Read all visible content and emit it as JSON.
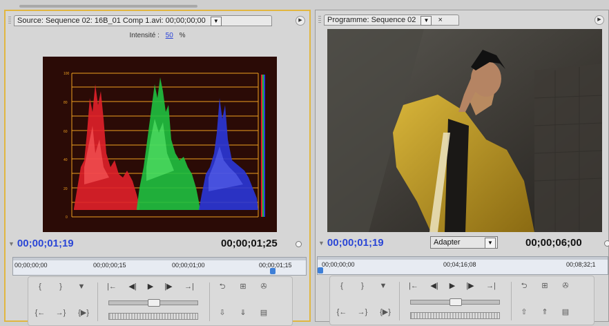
{
  "source": {
    "tab_title": "Source: Sequence 02: 16B_01 Comp 1.avi: 00;00;00;00",
    "dropdown_glyph": "▼",
    "menu_glyph": "▶",
    "intensity_label": "Intensité :",
    "intensity_value": "50",
    "intensity_unit": "%",
    "timecode_current": "00;00;01;19",
    "timecode_duration": "00;00;01;25",
    "ruler_ticks": [
      "00;00;00;00",
      "00;00;00;15",
      "00;00;01;00",
      "00;00;01;15"
    ]
  },
  "program": {
    "tab_title": "Programme: Sequence 02",
    "dropdown_glyph": "▼",
    "close_glyph": "×",
    "menu_glyph": "▶",
    "timecode_current": "00;00;01;19",
    "fit_label": "Adapter",
    "timecode_duration": "00;00;06;00",
    "ruler_ticks": [
      "00;00;00;00",
      "00;04;16;08",
      "00;08;32;1"
    ]
  },
  "controls": {
    "mark_in": "{",
    "mark_out": "}",
    "marker": "▼",
    "go_in": "{←",
    "go_out": "→}",
    "play_in_out": "{▶}",
    "go_prev_edit": "|←",
    "step_back": "◀|",
    "play": "▶",
    "step_forward": "|▶",
    "go_next_edit": "→|",
    "loop": "⮌",
    "safe_margins": "⊞",
    "output": "✇",
    "insert": "⇩",
    "overlay": "⇓",
    "lift": "⇧",
    "extract": "⇑",
    "export_frame": "▤"
  },
  "colors": {
    "source_timecode": "#2a46d6",
    "scope_background": "#2b0b06",
    "scope_grid": "#f0a020",
    "panel_highlight": "#e1b640"
  },
  "scope": {
    "type": "RGB parade",
    "scale_labels": [
      "100",
      "80",
      "60",
      "40",
      "20",
      "0"
    ]
  }
}
